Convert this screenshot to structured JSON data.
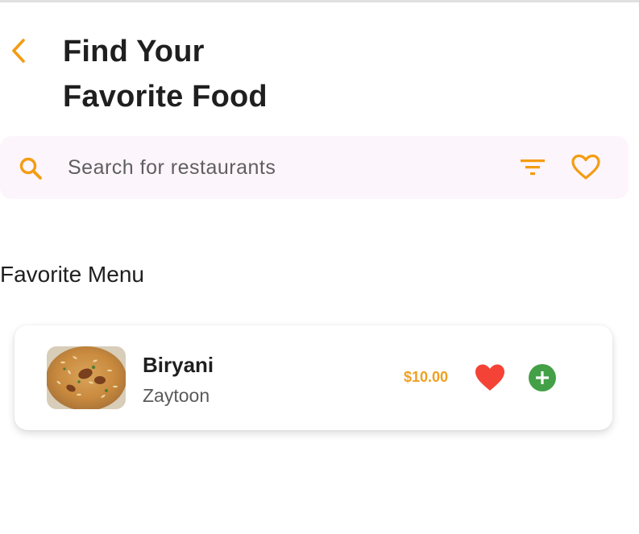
{
  "header": {
    "title_line1": "Find Your",
    "title_line2": "Favorite Food",
    "back_icon": "chevron-left-icon"
  },
  "search": {
    "placeholder": "Search for restaurants",
    "value": "",
    "search_icon": "search-icon",
    "filter_icon": "filter-icon",
    "favorites_icon": "heart-outline-icon"
  },
  "favorite_menu": {
    "title": "Favorite Menu",
    "items": [
      {
        "name": "Biryani",
        "restaurant": "Zaytoon",
        "price": "$10.00",
        "favorited": true,
        "image": "biryani-food-image"
      }
    ]
  },
  "colors": {
    "accent": "#f39c12",
    "price": "#f0a020",
    "heart": "#f44336",
    "add": "#43a047",
    "search_bg": "#fdf5fc"
  }
}
